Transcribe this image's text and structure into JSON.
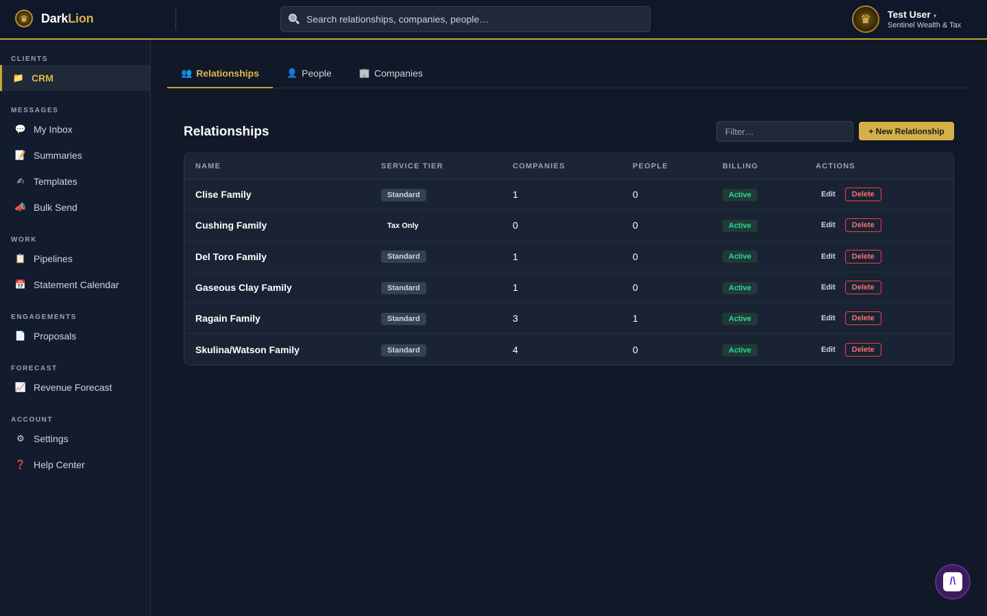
{
  "header": {
    "brand_dark": "Dark",
    "brand_lion": "Lion",
    "search_placeholder": "Search relationships, companies, people…",
    "user_name": "Test User",
    "user_org": "Sentinel Wealth & Tax",
    "caret": "▾"
  },
  "sidebar": {
    "sections": [
      {
        "title": "CLIENTS",
        "items": [
          {
            "label": "CRM",
            "icon": "📁",
            "active": true
          }
        ]
      },
      {
        "title": "MESSAGES",
        "items": [
          {
            "label": "My Inbox",
            "icon": "💬"
          },
          {
            "label": "Summaries",
            "icon": "📝"
          },
          {
            "label": "Templates",
            "icon": "✍"
          },
          {
            "label": "Bulk Send",
            "icon": "📣"
          }
        ]
      },
      {
        "title": "WORK",
        "items": [
          {
            "label": "Pipelines",
            "icon": "📋"
          },
          {
            "label": "Statement Calendar",
            "icon": "📅"
          }
        ]
      },
      {
        "title": "ENGAGEMENTS",
        "items": [
          {
            "label": "Proposals",
            "icon": "📄"
          }
        ]
      },
      {
        "title": "FORECAST",
        "items": [
          {
            "label": "Revenue Forecast",
            "icon": "📈"
          }
        ]
      },
      {
        "title": "ACCOUNT",
        "items": [
          {
            "label": "Settings",
            "icon": "⚙"
          },
          {
            "label": "Help Center",
            "icon": "❓"
          }
        ]
      }
    ]
  },
  "tabs": [
    {
      "label": "Relationships",
      "icon": "👥",
      "active": true
    },
    {
      "label": "People",
      "icon": "👤"
    },
    {
      "label": "Companies",
      "icon": "🏢"
    }
  ],
  "main": {
    "title": "Relationships",
    "filter_placeholder": "Filter…",
    "new_button": "+ New Relationship"
  },
  "table": {
    "headers": [
      "NAME",
      "SERVICE TIER",
      "COMPANIES",
      "PEOPLE",
      "BILLING",
      "ACTIONS"
    ],
    "edit_label": "Edit",
    "delete_label": "Delete",
    "rows": [
      {
        "name": "Clise Family",
        "tier": "Standard",
        "tier_badge": true,
        "companies": "1",
        "people": "0",
        "billing": "Active"
      },
      {
        "name": "Cushing Family",
        "tier": "Tax Only",
        "tier_badge": false,
        "companies": "0",
        "people": "0",
        "billing": "Active"
      },
      {
        "name": "Del Toro Family",
        "tier": "Standard",
        "tier_badge": true,
        "companies": "1",
        "people": "0",
        "billing": "Active"
      },
      {
        "name": "Gaseous Clay Family",
        "tier": "Standard",
        "tier_badge": true,
        "companies": "1",
        "people": "0",
        "billing": "Active"
      },
      {
        "name": "Ragain Family",
        "tier": "Standard",
        "tier_badge": true,
        "companies": "3",
        "people": "1",
        "billing": "Active"
      },
      {
        "name": "Skulina/Watson Family",
        "tier": "Standard",
        "tier_badge": true,
        "companies": "4",
        "people": "0",
        "billing": "Active"
      }
    ]
  },
  "fab": {
    "glyph": "/\\"
  },
  "colors": {
    "accent": "#c9a53a",
    "background": "#111827",
    "active_green": "#34d399",
    "danger": "#ef4444"
  }
}
